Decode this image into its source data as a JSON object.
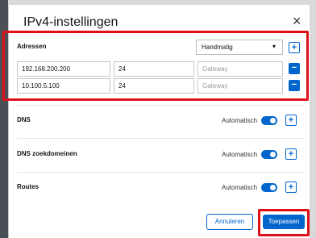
{
  "dialog": {
    "title": "IPv4-instellingen",
    "close": "×"
  },
  "addresses": {
    "label": "Adressen",
    "method": "Handmatig",
    "rows": [
      {
        "address": "192.168.200.200",
        "prefix": "24",
        "gateway_placeholder": "Gateway"
      },
      {
        "address": "10.100.5.100",
        "prefix": "24",
        "gateway_placeholder": "Gateway"
      }
    ]
  },
  "sections": [
    {
      "label": "DNS",
      "mode": "Automatisch"
    },
    {
      "label": "DNS zoekdomeinen",
      "mode": "Automatisch"
    },
    {
      "label": "Routes",
      "mode": "Automatisch"
    }
  ],
  "footer": {
    "cancel": "Annuleren",
    "apply": "Toepassen"
  },
  "icons": {
    "add": "+",
    "remove": "−",
    "caret": "▾"
  },
  "colors": {
    "accent": "#0066cc",
    "highlight": "#e0101a"
  }
}
